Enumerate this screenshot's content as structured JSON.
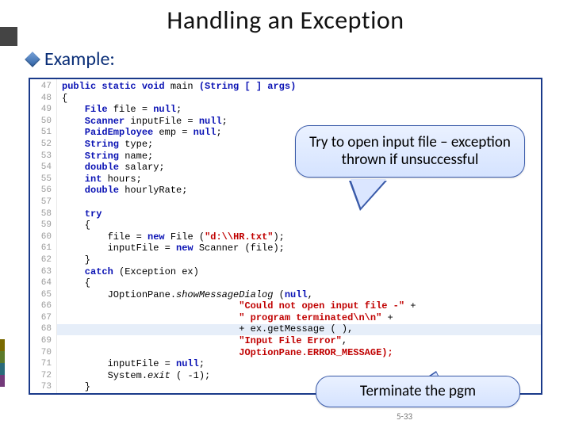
{
  "title": "Handling an Exception",
  "bullet": "Example:",
  "callouts": {
    "c1": "Try to open input file – exception thrown if unsuccessful",
    "c2": "Terminate the pgm"
  },
  "page_number": "5-33",
  "gutter_lines": [
    "47",
    "48",
    "49",
    "50",
    "51",
    "52",
    "53",
    "54",
    "55",
    "56",
    "57",
    "58",
    "59",
    "60",
    "61",
    "62",
    "63",
    "64",
    "65",
    "66",
    "67",
    "68",
    "69",
    "70",
    "71",
    "72",
    "73"
  ],
  "code": {
    "l47a": "public static void",
    "l47b": " main ",
    "l47c": "(String [ ] args)",
    "l48": "{",
    "l49a": "    File ",
    "l49b": "file = ",
    "l49c": "null",
    "l49d": ";",
    "l50a": "    Scanner ",
    "l50b": "inputFile = ",
    "l50c": "null",
    "l50d": ";",
    "l51a": "    PaidEmployee ",
    "l51b": "emp = ",
    "l51c": "null",
    "l51d": ";",
    "l52a": "    String ",
    "l52b": "type;",
    "l53a": "    String ",
    "l53b": "name;",
    "l54a": "    double ",
    "l54b": "salary;",
    "l55a": "    int ",
    "l55b": "hours;",
    "l56a": "    double ",
    "l56b": "hourlyRate;",
    "l57": "",
    "l58a": "    try",
    "l59": "    {",
    "l60a": "        file = ",
    "l60b": "new ",
    "l60c": "File (",
    "l60d": "\"d:\\\\HR.txt\"",
    "l60e": ");",
    "l61a": "        inputFile = ",
    "l61b": "new ",
    "l61c": "Scanner (file);",
    "l62": "    }",
    "l63a": "    catch ",
    "l63b": "(Exception ex)",
    "l64": "    {",
    "l65a": "        JOptionPane.",
    "l65b": "showMessageDialog ",
    "l65c": "(",
    "l65d": "null",
    "l65e": ",",
    "l66a": "                               ",
    "l66b": "\"Could not open input file -\"",
    "l66c": " +",
    "l67a": "                               ",
    "l67b": "\" program terminated\\n\\n\"",
    "l67c": " +",
    "l68a": "                               ",
    "l68b": "+ ex.getMessage ( ),",
    "l69a": "                               ",
    "l69b": "\"Input File Error\"",
    "l69c": ",",
    "l70a": "                               ",
    "l70b": "JOptionPane.ERROR_MESSAGE);",
    "l71a": "        inputFile = ",
    "l71b": "null",
    "l71c": ";",
    "l72a": "        System.",
    "l72b": "exit ",
    "l72c": "( -1);",
    "l73": "    }"
  }
}
